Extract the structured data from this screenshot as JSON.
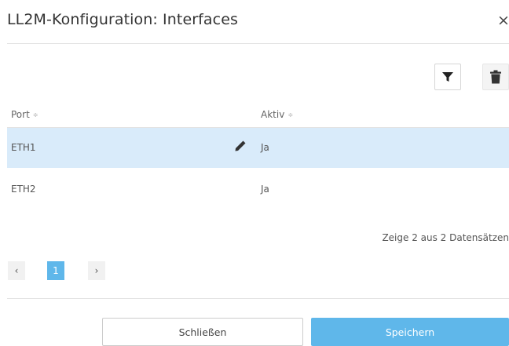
{
  "dialog": {
    "title": "LL2M-Konfiguration: Interfaces",
    "close_label": "×"
  },
  "toolbar": {
    "filter_icon": "filter-icon",
    "delete_icon": "trash-icon"
  },
  "table": {
    "columns": [
      {
        "label": "Port",
        "sort_glyph": "≑"
      },
      {
        "label": "Aktiv",
        "sort_glyph": "≑"
      }
    ],
    "rows": [
      {
        "port": "ETH1",
        "aktiv": "Ja",
        "selected": true,
        "edit_icon": "pencil-icon"
      },
      {
        "port": "ETH2",
        "aktiv": "Ja",
        "selected": false
      }
    ],
    "summary": "Zeige 2 aus 2 Datensätzen"
  },
  "pagination": {
    "prev_label": "‹",
    "current_page": "1",
    "next_label": "›"
  },
  "actions": {
    "close_label": "Schließen",
    "save_label": "Speichern"
  },
  "colors": {
    "accent": "#5fb7ea",
    "selected_row": "#d9ebfa"
  }
}
